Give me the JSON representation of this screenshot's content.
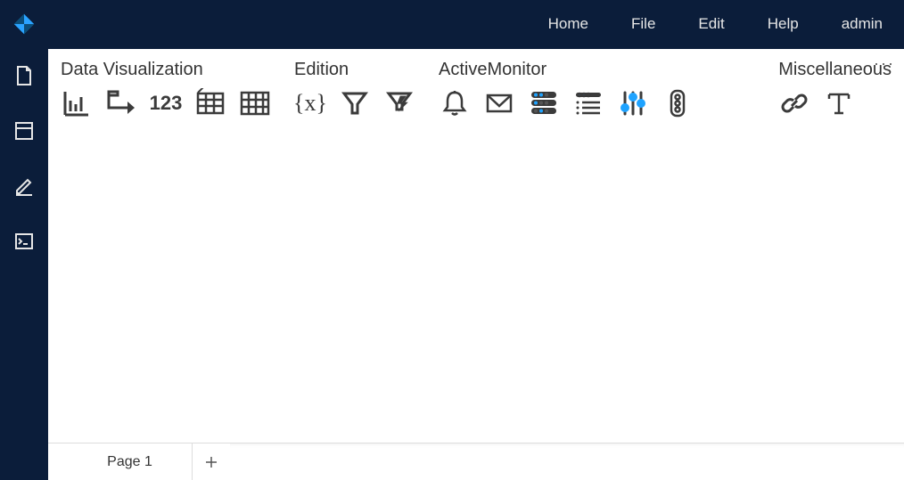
{
  "nav": {
    "items": [
      {
        "label": "Home"
      },
      {
        "label": "File"
      },
      {
        "label": "Edit"
      },
      {
        "label": "Help"
      },
      {
        "label": "admin"
      }
    ]
  },
  "sidebar": {
    "items": [
      {
        "name": "page-icon"
      },
      {
        "name": "panel-icon"
      },
      {
        "name": "edit-icon"
      },
      {
        "name": "console-icon"
      }
    ]
  },
  "groups": {
    "dataviz": {
      "title": "Data Visualization",
      "tools": [
        {
          "name": "bar-chart-icon"
        },
        {
          "name": "trend-arrow-icon"
        },
        {
          "name": "numeric-123-icon",
          "label": "123"
        },
        {
          "name": "grid-small-icon"
        },
        {
          "name": "grid-large-icon"
        }
      ]
    },
    "edition": {
      "title": "Edition",
      "tools": [
        {
          "name": "variable-braces-icon",
          "label": "{x}"
        },
        {
          "name": "funnel-icon"
        },
        {
          "name": "funnel-bolt-icon"
        }
      ]
    },
    "activemonitor": {
      "title": "ActiveMonitor",
      "tools": [
        {
          "name": "bell-icon"
        },
        {
          "name": "mail-icon"
        },
        {
          "name": "io-panel-icon"
        },
        {
          "name": "list-lines-icon"
        },
        {
          "name": "sliders-vertical-icon"
        },
        {
          "name": "traffic-light-icon"
        }
      ]
    },
    "misc": {
      "title": "Miscellaneous",
      "tools": [
        {
          "name": "link-icon"
        },
        {
          "name": "text-icon"
        }
      ]
    }
  },
  "tabs": {
    "items": [
      {
        "label": "Page 1"
      }
    ],
    "add_label": "+"
  },
  "more_label": "···"
}
